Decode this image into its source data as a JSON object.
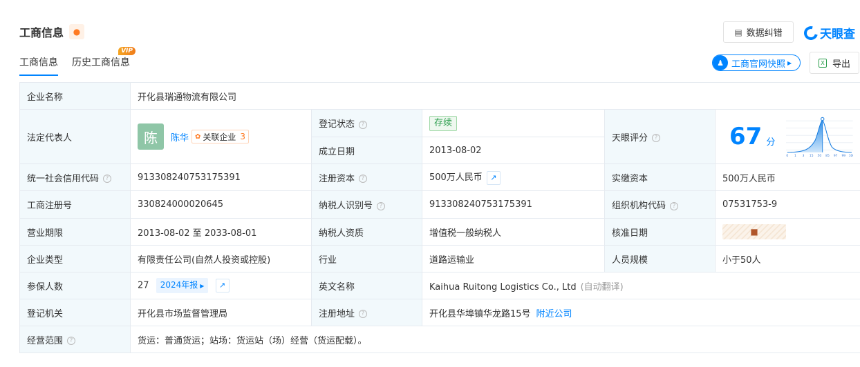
{
  "header": {
    "title": "工商信息",
    "correct_btn": "数据纠错",
    "logo_text": "天眼查"
  },
  "tabs": [
    {
      "label": "工商信息",
      "active": true
    },
    {
      "label": "历史工商信息",
      "badge": "VIP"
    }
  ],
  "actions": {
    "snapshot_btn": "工商官网快照",
    "export_btn": "导出"
  },
  "info": {
    "company_name": {
      "label": "企业名称",
      "value": "开化县瑞通物流有限公司"
    },
    "legal_rep": {
      "label": "法定代表人",
      "avatar_char": "陈",
      "name": "陈华",
      "related_label": "关联企业",
      "related_count": "3"
    },
    "reg_status": {
      "label": "登记状态",
      "value": "存续"
    },
    "found_date": {
      "label": "成立日期",
      "value": "2013-08-02"
    },
    "score": {
      "label": "天眼评分",
      "value": "67",
      "unit": "分",
      "axis_labels": [
        "0",
        "1",
        "3",
        "15",
        "50",
        "85",
        "97",
        "99",
        "100"
      ]
    },
    "credit_code": {
      "label": "统一社会信用代码",
      "value": "913308240753175391"
    },
    "reg_capital": {
      "label": "注册资本",
      "value": "500万人民币"
    },
    "paid_capital": {
      "label": "实缴资本",
      "value": "500万人民币"
    },
    "reg_number": {
      "label": "工商注册号",
      "value": "330824000020645"
    },
    "taxpayer_id": {
      "label": "纳税人识别号",
      "value": "913308240753175391"
    },
    "org_code": {
      "label": "组织机构代码",
      "value": "07531753-9"
    },
    "term": {
      "label": "营业期限",
      "value": "2013-08-02 至 2033-08-01"
    },
    "tax_qual": {
      "label": "纳税人资质",
      "value": "增值税一般纳税人"
    },
    "approve_date": {
      "label": "核准日期"
    },
    "company_type": {
      "label": "企业类型",
      "value": "有限责任公司(自然人投资或控股)"
    },
    "industry": {
      "label": "行业",
      "value": "道路运输业"
    },
    "staff_size": {
      "label": "人员规模",
      "value": "小于50人"
    },
    "insured": {
      "label": "参保人数",
      "value": "27",
      "year_badge": "2024年报"
    },
    "english_name": {
      "label": "英文名称",
      "value": "Kaihua Ruitong Logistics Co., Ltd",
      "note": "(自动翻译)"
    },
    "reg_authority": {
      "label": "登记机关",
      "value": "开化县市场监督管理局"
    },
    "reg_address": {
      "label": "注册地址",
      "value": "开化县华埠镇华龙路15号",
      "link": "附近公司"
    },
    "business_scope": {
      "label": "经营范围",
      "value": "货运：普通货运；站场：货运站（场）经营（货运配载）。"
    }
  },
  "colors": {
    "accent": "#0084ff",
    "label_bg": "#f2f9fc",
    "status_green": "#2a9d4b",
    "warn_orange": "#ff7a22"
  }
}
